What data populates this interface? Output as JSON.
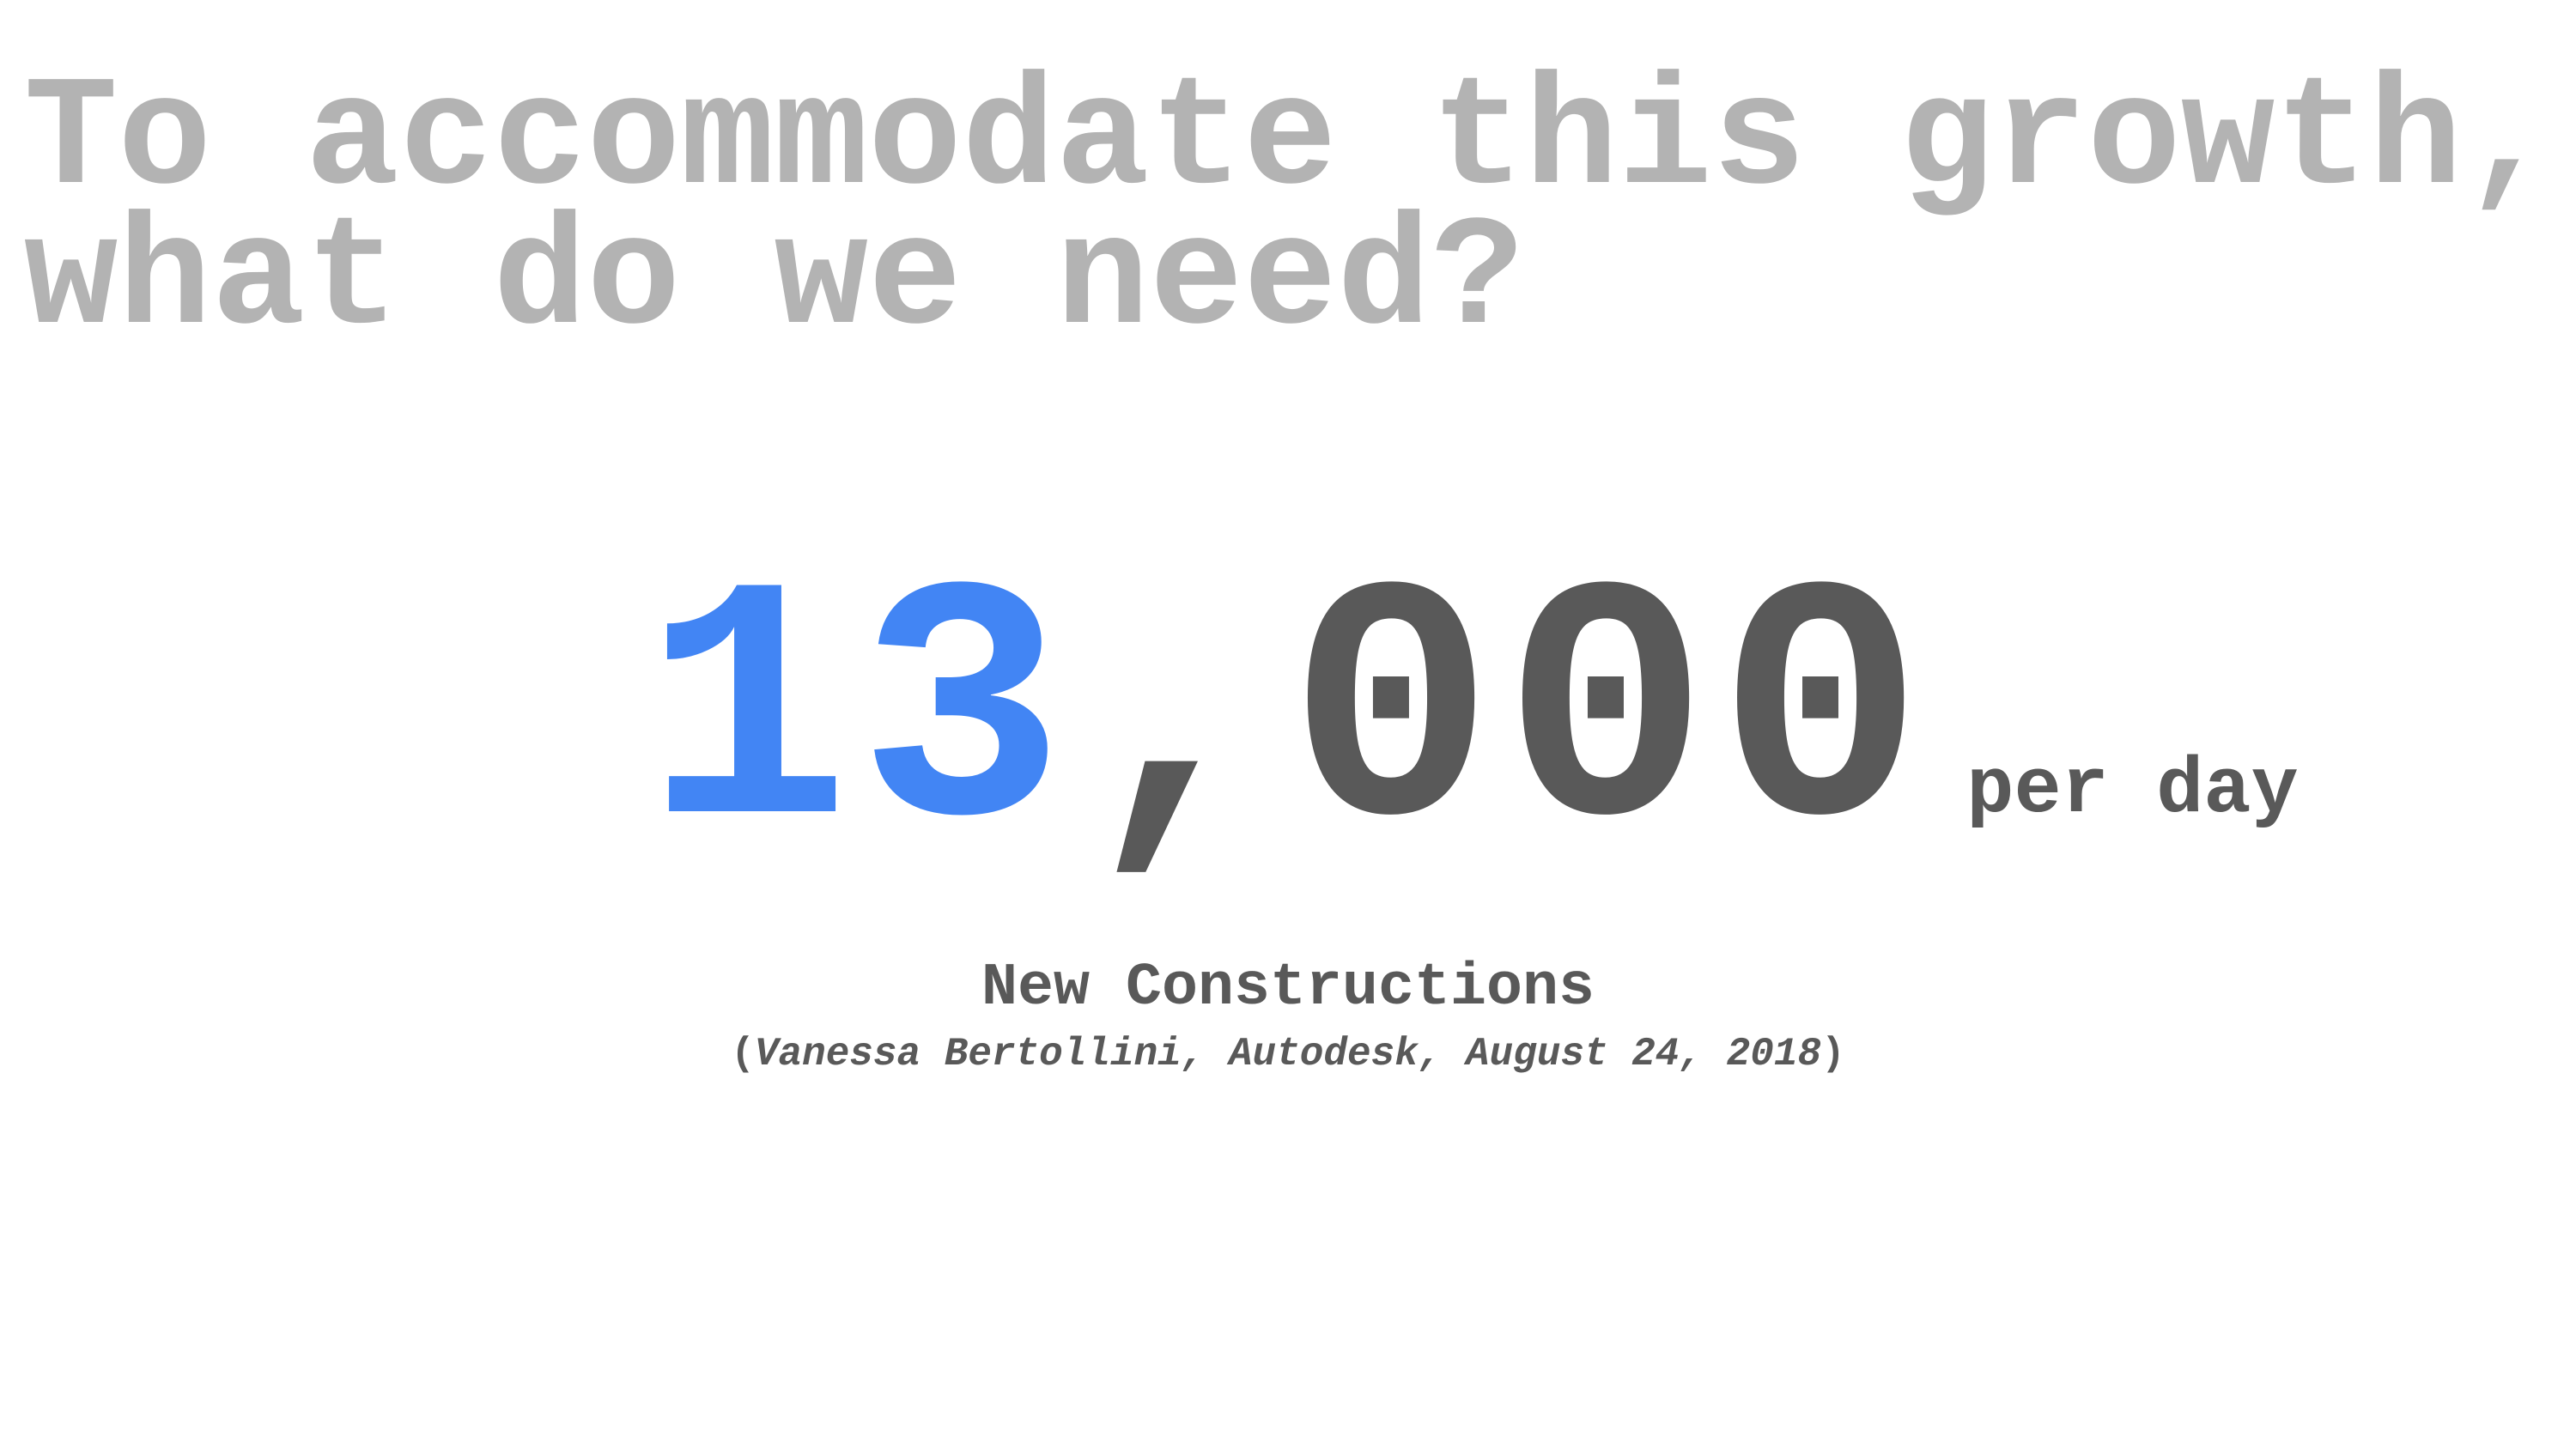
{
  "headline": {
    "line1": "To accommodate this growth,",
    "line2": "what do we need?"
  },
  "stat": {
    "number_highlight": "13",
    "number_rest": ",000",
    "unit": "per day"
  },
  "caption": "New Constructions",
  "source": {
    "open": "(",
    "text": "Vanessa Bertollini, Autodesk, August 24, 2018",
    "close": ")"
  },
  "colors": {
    "headline": "#b3b3b3",
    "accent": "#4285f4",
    "text": "#595959",
    "background": "#ffffff"
  }
}
